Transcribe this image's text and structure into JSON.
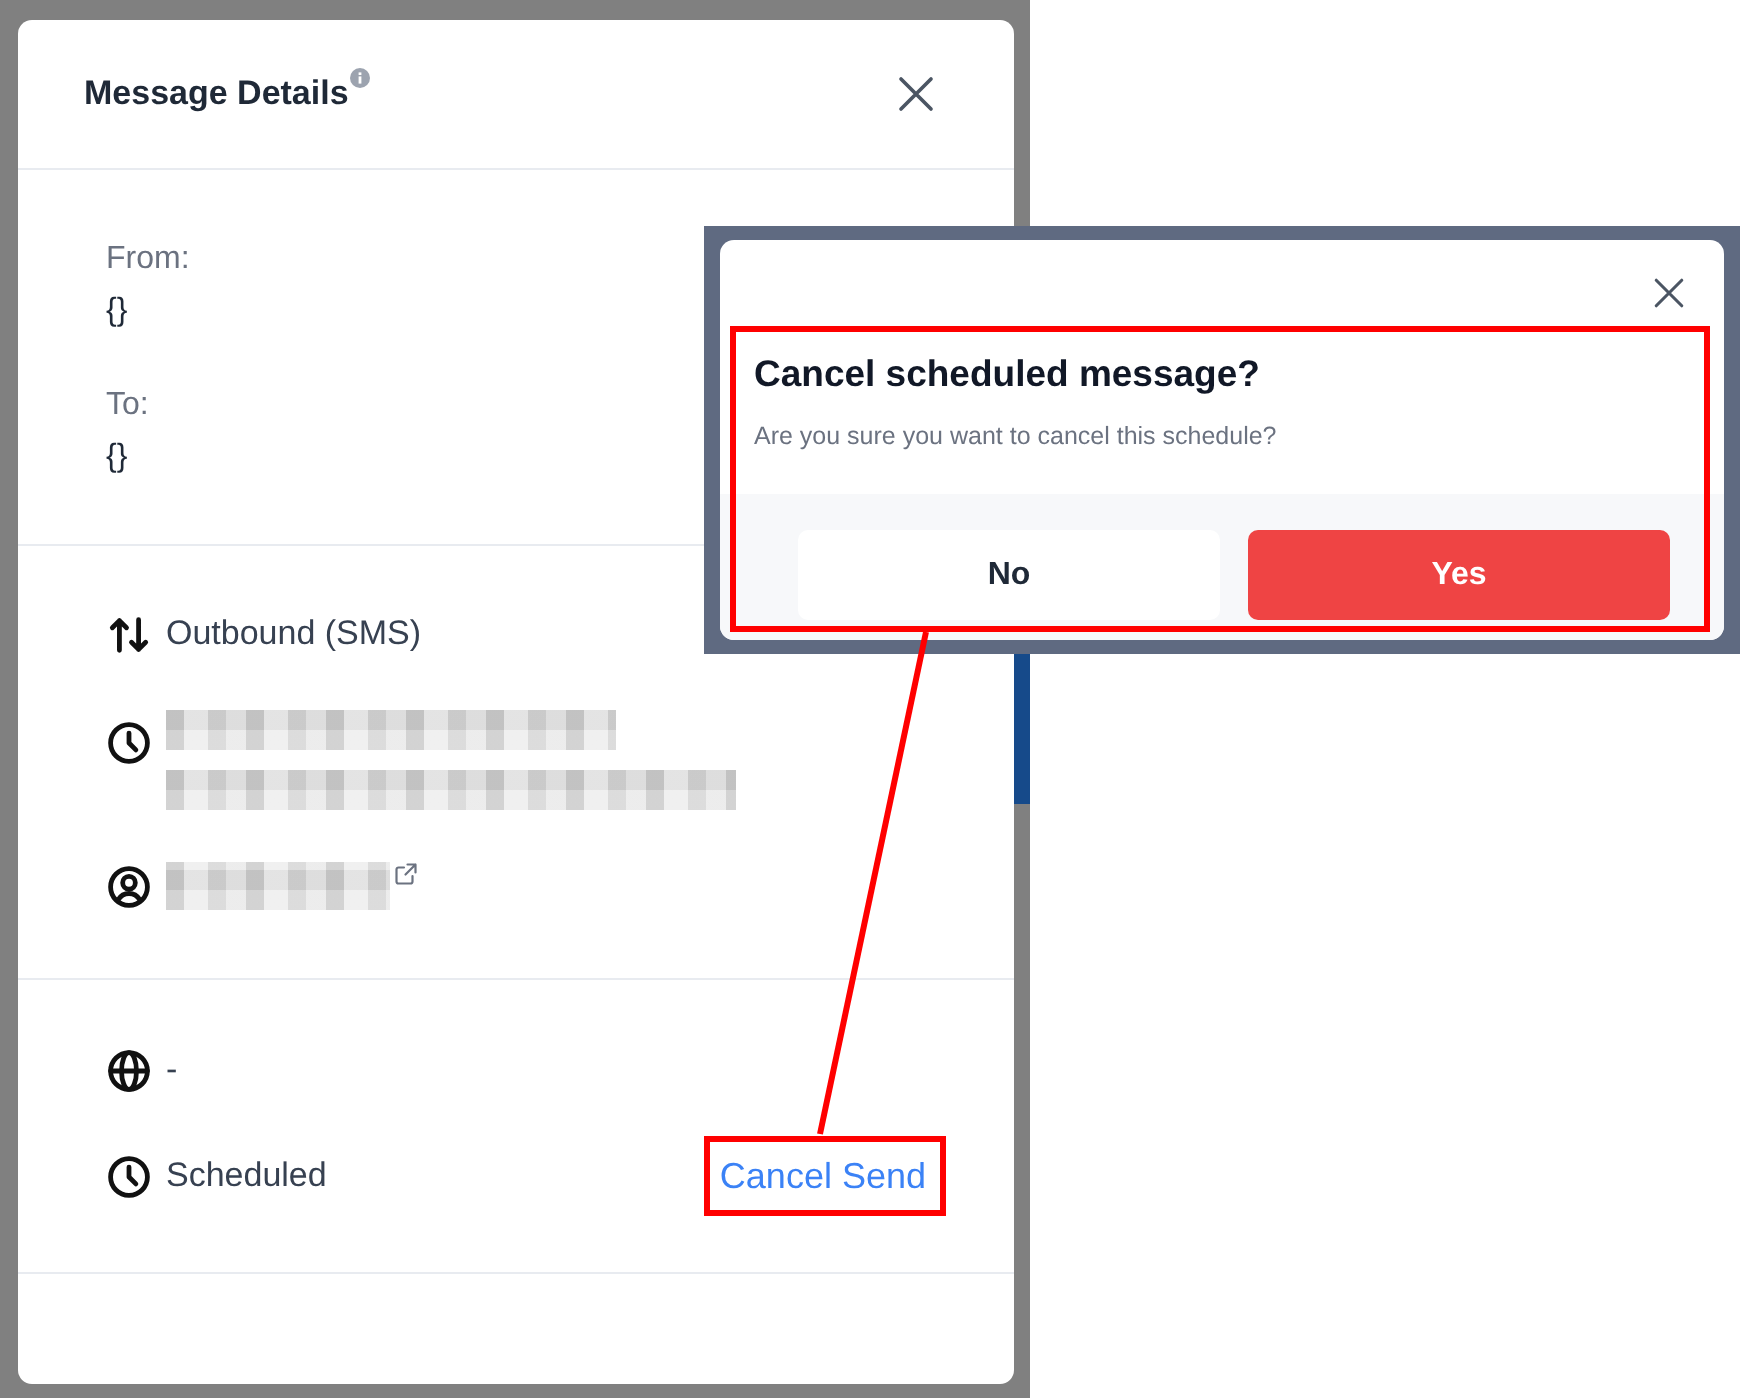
{
  "details_panel": {
    "title": "Message Details",
    "parties": [
      {
        "label": "From:",
        "value": "{}"
      },
      {
        "label": "To:",
        "value": "{}"
      }
    ],
    "sections": [
      {
        "rows": [
          {
            "kind": "direction",
            "text": "Outbound (SMS)"
          },
          {
            "kind": "timestamp",
            "blurred": true
          },
          {
            "kind": "contact",
            "blurred": true
          }
        ]
      },
      {
        "rows": [
          {
            "kind": "timezone",
            "text": "-"
          },
          {
            "kind": "status",
            "text": "Scheduled",
            "action": "Cancel Send"
          }
        ]
      }
    ]
  },
  "confirm_dialog": {
    "title": "Cancel scheduled message?",
    "message": "Are you sure you want to cancel this schedule?",
    "buttons": [
      {
        "label": "No",
        "kind": "secondary"
      },
      {
        "label": "Yes",
        "kind": "primary"
      }
    ]
  }
}
